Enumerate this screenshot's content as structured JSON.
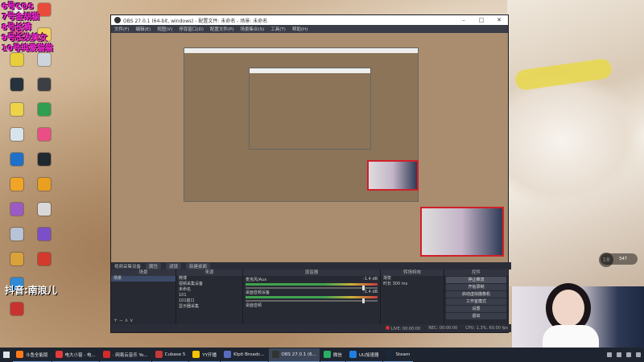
{
  "overlay_lines": [
    "6号COS",
    "7号金胡猫",
    "8号长裤",
    "9号长发美女",
    "10号纯爱猫猫"
  ],
  "douyin_label": "抖音:南浪儿",
  "desktop_icons": [
    {
      "label": "",
      "color": "#e9e3d8"
    },
    {
      "label": "",
      "color": "#d04f8b"
    },
    {
      "label": "",
      "color": "#e7cf39"
    },
    {
      "label": "",
      "color": "#27323c"
    },
    {
      "label": "",
      "color": "#eed248"
    },
    {
      "label": "",
      "color": "#d8e4ec"
    },
    {
      "label": "",
      "color": "#1e70c9"
    },
    {
      "label": "",
      "color": "#f0a526"
    },
    {
      "label": "",
      "color": "#9c5bc4"
    },
    {
      "label": "",
      "color": "#b7c3d6"
    },
    {
      "label": "",
      "color": "#d9a23a"
    },
    {
      "label": "",
      "color": "#2f8ad7"
    },
    {
      "label": "",
      "color": "#c8332f"
    },
    {
      "label": "",
      "color": "#e84b3c"
    },
    {
      "label": "",
      "color": "#f0d25a"
    },
    {
      "label": "",
      "color": "#cdd4dd"
    },
    {
      "label": "",
      "color": "#3c3f44"
    },
    {
      "label": "",
      "color": "#2f9e50"
    },
    {
      "label": "",
      "color": "#e94e86"
    },
    {
      "label": "",
      "color": "#202830"
    },
    {
      "label": "",
      "color": "#e9a020"
    },
    {
      "label": "",
      "color": "#d8d8d8"
    },
    {
      "label": "",
      "color": "#7a4fc9"
    },
    {
      "label": "",
      "color": "#d33a2c"
    }
  ],
  "obs": {
    "title": "OBS 27.0.1 (64-bit, windows) - 配置文件: 未命名 - 场景: 未命名",
    "menu": [
      "文件(F)",
      "编辑(E)",
      "视图(V)",
      "停靠窗口(D)",
      "配置文件(P)",
      "场景集合(S)",
      "工具(T)",
      "帮助(H)"
    ],
    "source_bar": {
      "label": "视频采集设备",
      "btn1": "属性",
      "btn2": "滤镜",
      "btn3": "新建桌面"
    },
    "scenes_title": "场景",
    "scenes": [
      "场景"
    ],
    "sources_title": "来源",
    "sources": [
      "微博",
      "视频采集设备",
      "未命名",
      "101",
      "101窗口",
      "显示器采集"
    ],
    "mixer_title": "混音器",
    "mixer": [
      {
        "name": "麦克风/Aux",
        "db": "-1.4 dB"
      },
      {
        "name": "桌面音频设备",
        "db": "-1.4 dB"
      },
      {
        "name": "桌面音频",
        "db": ""
      }
    ],
    "transition_title": "转场特效",
    "transition": {
      "type": "渐变",
      "duration_label": "时长",
      "duration": "300 ms"
    },
    "controls_title": "控件",
    "controls": [
      "停止推流",
      "开始录制",
      "启动虚拟摄像机",
      "工作室模式",
      "设置",
      "退出"
    ],
    "status": {
      "live": "LIVE: 00:00:00",
      "rec": "REC: 00:00:00",
      "cpu": "CPU: 1.3%, 60.00 fps"
    }
  },
  "stats_badge": "547",
  "num_badge": "18",
  "taskbar": {
    "items": [
      {
        "label": "斗鱼全能版",
        "color": "#ff7a1a",
        "active": false
      },
      {
        "label": "电大小窗 - 电...",
        "color": "#e33a3a",
        "active": false
      },
      {
        "label": "· 网易云音乐 Yo...",
        "color": "#d12c2c",
        "active": false
      },
      {
        "label": "Cubase 5",
        "color": "#c63838",
        "active": false
      },
      {
        "label": "YY开播",
        "color": "#f2c300",
        "active": false
      },
      {
        "label": "Klpit Broadc...",
        "color": "#5a6cc0",
        "active": false
      },
      {
        "label": "OBS 27.0.1 (6...",
        "color": "#333",
        "active": true
      },
      {
        "label": "微信",
        "color": "#2aae67",
        "active": false
      },
      {
        "label": "UU加速器",
        "color": "#1f7ee0",
        "active": false
      },
      {
        "label": "Steam",
        "color": "#1b2838",
        "active": false
      }
    ]
  }
}
